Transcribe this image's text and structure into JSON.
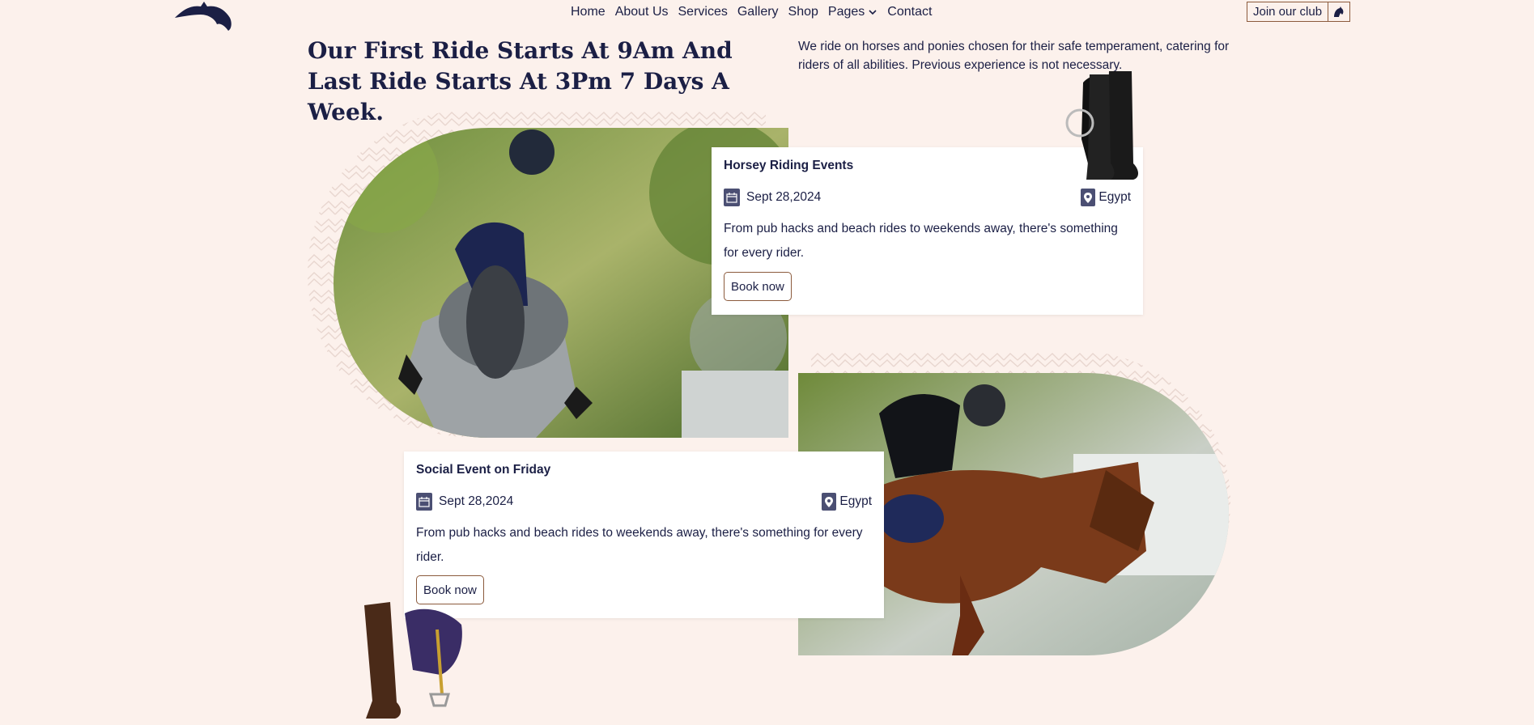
{
  "header": {
    "logo_icon": "horse-head-logo-icon",
    "nav": [
      {
        "label": "Home"
      },
      {
        "label": "About Us"
      },
      {
        "label": "Services"
      },
      {
        "label": "Gallery"
      },
      {
        "label": "Shop"
      },
      {
        "label": "Pages"
      },
      {
        "label": "Contact"
      }
    ],
    "join_label": "Join our club",
    "join_icon": "horse-head-icon"
  },
  "hero": {
    "heading": "Our First Ride Starts At 9Am And Last Ride Starts At 3Pm 7 Days A Week.",
    "intro": "We ride on horses and ponies chosen for their safe temperament, catering for riders of all abilities. Previous experience is not necessary."
  },
  "events": [
    {
      "title": "Horsey Riding Events",
      "date": "Sept 28,2024",
      "location": "Egypt",
      "description": "From pub hacks and beach rides to weekends away, there's something for every rider.",
      "button": "Book now"
    },
    {
      "title": "Social Event on Friday",
      "date": "Sept 28,2024",
      "location": "Egypt",
      "description": "From pub hacks and beach rides to weekends away, there's something for every rider.",
      "button": "Book now"
    }
  ],
  "colors": {
    "background": "#fcf1ec",
    "navy": "#1b1f45",
    "button_border": "#8b5a3c",
    "card": "#ffffff"
  }
}
